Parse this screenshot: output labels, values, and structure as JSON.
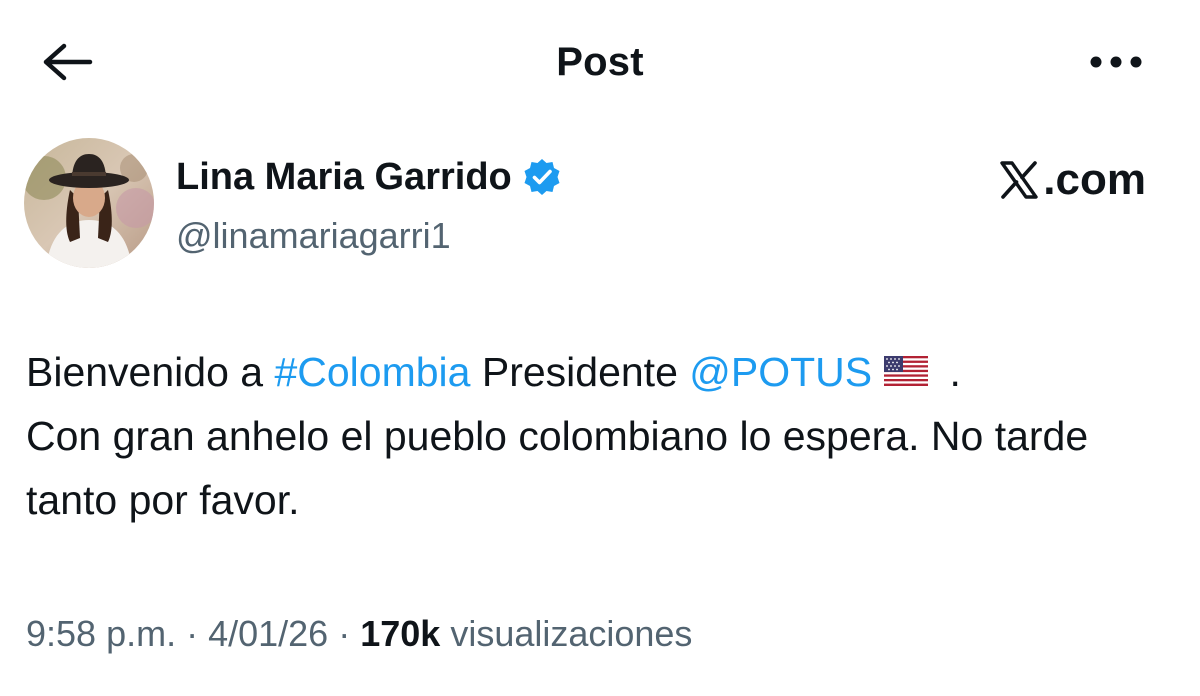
{
  "header": {
    "title": "Post",
    "back_icon": "arrow-left-icon",
    "more_icon": "more-horizontal-icon"
  },
  "author": {
    "display_name": "Lina Maria Garrido",
    "handle": "@linamariagarri1",
    "verified": true,
    "verified_color": "#1d9bf0",
    "avatar_icon": "avatar-photo"
  },
  "brand": {
    "logo_icon": "x-logo-icon",
    "text": ".com"
  },
  "post": {
    "line1_text_a": "Bienvenido a ",
    "hashtag": "#Colombia",
    "line1_text_b": " Presidente ",
    "mention": "@POTUS",
    "flag_icon": "us-flag-icon",
    "line1_text_c": " .",
    "rest_text": "Con gran anhelo el pueblo colombiano lo espera. No tarde tanto por favor."
  },
  "meta": {
    "time": "9:58 p.m.",
    "sep1": " · ",
    "date": "4/01/26",
    "sep2": " · ",
    "views_count": "170k",
    "views_label": " visualizaciones"
  },
  "colors": {
    "text": "#0f1419",
    "secondary": "#536471",
    "link": "#1d9bf0"
  }
}
